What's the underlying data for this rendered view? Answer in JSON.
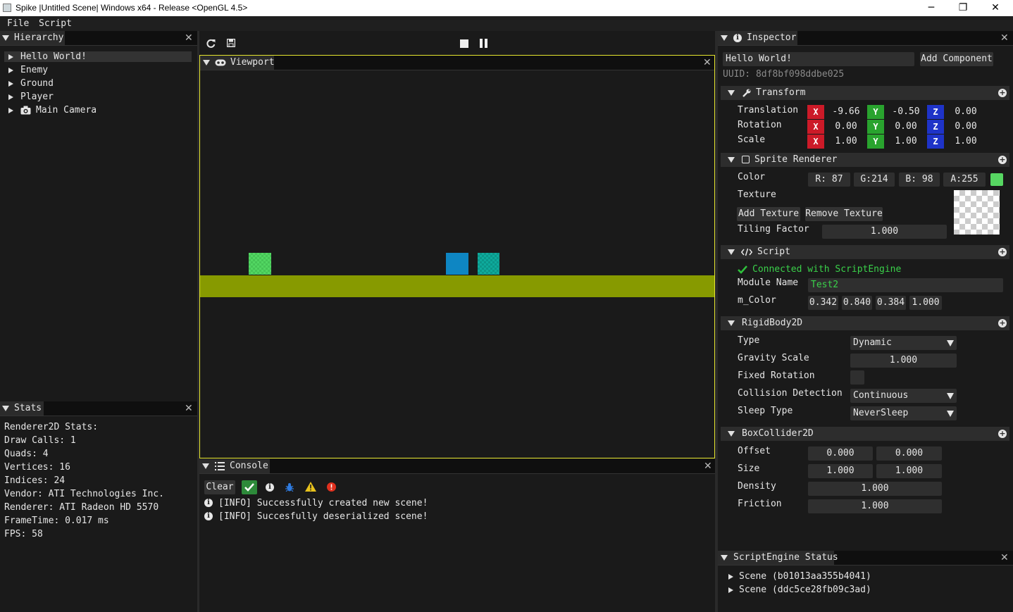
{
  "window": {
    "title": "Spike |Untitled Scene| Windows x64 - Release <OpenGL 4.5>",
    "min_glyph": "─",
    "restore_glyph": "❐",
    "close_glyph": "✕"
  },
  "menu": {
    "items": [
      "File",
      "Script"
    ]
  },
  "hierarchy": {
    "title": "Hierarchy",
    "items": [
      "Hello World!",
      "Enemy",
      "Ground",
      "Player",
      "Main Camera"
    ],
    "selected_index": 0
  },
  "stats": {
    "title": "Stats",
    "lines": [
      "Renderer2D Stats:",
      "Draw Calls: 1",
      "Quads: 4",
      "Vertices: 16",
      "Indices: 24",
      "Vendor: ATI Technologies Inc.",
      "Renderer: ATI Radeon HD 5570",
      "FrameTime: 0.017 ms",
      "FPS: 58"
    ]
  },
  "toolbar": {
    "icons": [
      "refresh-icon",
      "save-icon",
      "stop-icon",
      "pause-icon"
    ]
  },
  "viewport": {
    "title": "Viewport",
    "ground_color": "#879a00",
    "sprite_green": "#52d662",
    "sprite_blue": "#0e86c3",
    "sprite_teal": "#0eaa9c",
    "border_color": "#e5e52e"
  },
  "console": {
    "title": "Console",
    "clear_label": "Clear",
    "messages": [
      "[INFO] Successfully created new scene!",
      "[INFO] Succesfully deserialized scene!"
    ]
  },
  "inspector": {
    "title": "Inspector",
    "entity_name": "Hello World!",
    "add_component_label": "Add Component",
    "uuid": "UUID: 8df8bf098ddbe025",
    "transform": {
      "title": "Transform",
      "rows": [
        {
          "label": "Translation",
          "x": "-9.66",
          "y": "-0.50",
          "z": "0.00"
        },
        {
          "label": "Rotation",
          "x": "0.00",
          "y": "0.00",
          "z": "0.00"
        },
        {
          "label": "Scale",
          "x": "1.00",
          "y": "1.00",
          "z": "1.00"
        }
      ],
      "axis_labels": [
        "X",
        "Y",
        "Z"
      ]
    },
    "sprite_renderer": {
      "title": "Sprite Renderer",
      "color_label": "Color",
      "r": "R: 87",
      "g": "G:214",
      "b": "B: 98",
      "a": "A:255",
      "swatch_color": "#57d662",
      "texture_label": "Texture",
      "add_texture_label": "Add Texture",
      "remove_texture_label": "Remove Texture",
      "tiling_label": "Tiling Factor",
      "tiling_value": "1.000"
    },
    "script": {
      "title": "Script",
      "status": "Connected with ScriptEngine",
      "module_label": "Module Name",
      "module_value": "Test2",
      "color_field_label": "m_Color",
      "color_values": [
        "0.342",
        "0.840",
        "0.384",
        "1.000"
      ]
    },
    "rigidbody": {
      "title": "RigidBody2D",
      "type_label": "Type",
      "type_value": "Dynamic",
      "gravity_label": "Gravity Scale",
      "gravity_value": "1.000",
      "fixed_rotation_label": "Fixed Rotation",
      "collision_label": "Collision Detection",
      "collision_value": "Continuous",
      "sleep_label": "Sleep Type",
      "sleep_value": "NeverSleep"
    },
    "boxcollider": {
      "title": "BoxCollider2D",
      "offset_label": "Offset",
      "offset_values": [
        "0.000",
        "0.000"
      ],
      "size_label": "Size",
      "size_values": [
        "1.000",
        "1.000"
      ],
      "density_label": "Density",
      "density_value": "1.000",
      "friction_label": "Friction",
      "friction_value": "1.000"
    }
  },
  "script_engine": {
    "title": "ScriptEngine Status",
    "scenes": [
      "Scene (b01013aa355b4041)",
      "Scene (ddc5ce28fb09c3ad)"
    ]
  }
}
